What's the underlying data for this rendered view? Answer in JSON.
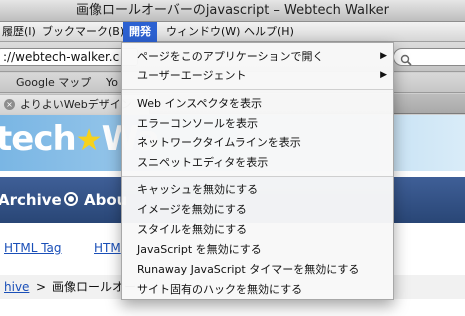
{
  "window": {
    "title": "画像ロールオーバーのjavascript – Webtech Walker"
  },
  "menubar": {
    "items": [
      {
        "label": "履歴(I)"
      },
      {
        "label": "ブックマーク(B)"
      },
      {
        "label": "開発"
      },
      {
        "label": "ウィンドウ(W)"
      },
      {
        "label": "ヘルプ(H)"
      }
    ]
  },
  "toolbar": {
    "url": "://webtech-walker.c"
  },
  "bookmarks": {
    "items": [
      {
        "label": "Google マップ"
      },
      {
        "label": "Yo"
      }
    ]
  },
  "tab": {
    "title": "よりよいWebデザイン"
  },
  "page": {
    "logo_text": "tech",
    "logo_star": "★",
    "logo_text2": "Wa",
    "nav": [
      {
        "label": "Archive"
      },
      {
        "label": "Abou"
      }
    ],
    "links": [
      {
        "label": "HTML Tag"
      },
      {
        "label": "HTM"
      }
    ],
    "breadcrumb": {
      "link": "hive",
      "sep": ">",
      "current": "画像ロールオー"
    }
  },
  "dropdown": {
    "items": [
      {
        "label": "ページをこのアプリケーションで開く",
        "submenu": true
      },
      {
        "label": "ユーザーエージェント",
        "submenu": true
      },
      {
        "label": "Web インスペクタを表示"
      },
      {
        "label": "エラーコンソールを表示"
      },
      {
        "label": "ネットワークタイムラインを表示"
      },
      {
        "label": "スニペットエディタを表示"
      },
      {
        "label": "キャッシュを無効にする"
      },
      {
        "label": "イメージを無効にする"
      },
      {
        "label": "スタイルを無効にする"
      },
      {
        "label": "JavaScript を無効にする"
      },
      {
        "label": "Runaway JavaScript タイマーを無効にする"
      },
      {
        "label": "サイト固有のハックを無効にする"
      }
    ]
  },
  "icons": {
    "submenu_arrow": "▶",
    "close": "×"
  }
}
